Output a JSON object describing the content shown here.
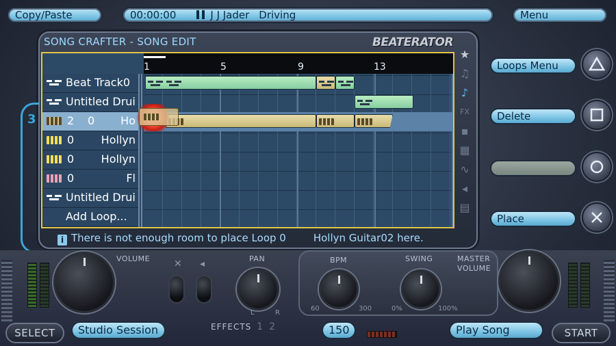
{
  "top_bar": {
    "left_label": "Copy/Paste",
    "time": "00:00:00",
    "artist": "J J Jader",
    "song": "Driving",
    "right_label": "Menu"
  },
  "screen": {
    "title": "SONG CRAFTER - SONG EDIT",
    "brand": "BEATERATOR",
    "ruler": [
      "1",
      "5",
      "9",
      "13"
    ],
    "status_icon": "i",
    "status_text": "There is not enough room to place Loop 0",
    "status_text2": "Hollyn Guitar02 here."
  },
  "tracks": [
    {
      "icon": "drum-icon",
      "label": "Beat Track0"
    },
    {
      "icon": "drum-icon",
      "label": "Untitled Drui"
    },
    {
      "icon": "keys-icon",
      "num1": "2",
      "num2": "0",
      "right": "Ho"
    },
    {
      "icon": "keys-icon",
      "num1": "0",
      "right": "Hollyn"
    },
    {
      "icon": "keys-icon",
      "num1": "0",
      "right": "Hollyn"
    },
    {
      "icon": "keys-icon-pink",
      "num1": "0",
      "right": "Fl"
    },
    {
      "icon": "drum-icon",
      "label": "Untitled Drui"
    },
    {
      "label": "Add Loop..."
    }
  ],
  "selected_track_number": "3",
  "right_buttons": {
    "loops_menu": "Loops Menu",
    "delete": "Delete",
    "blank": "",
    "place": "Place"
  },
  "bottom": {
    "volume_label": "VOLUME",
    "pan_label": "PAN",
    "pan_l": "L",
    "pan_r": "R",
    "effects_label": "EFFECTS",
    "effects_1": "1",
    "effects_2": "2",
    "bpm_label": "BPM",
    "bpm_min": "60",
    "bpm_max": "300",
    "bpm_value": "150",
    "swing_label": "SWING",
    "swing_min": "0%",
    "swing_max": "100%",
    "master_label": "MASTER",
    "master_label2": "VOLUME",
    "select": "SELECT",
    "studio_session": "Studio Session",
    "play_song": "Play Song",
    "start": "START"
  },
  "colors": {
    "accent": "#7cc4e4",
    "editor_border": "#e0c64a",
    "clip_green": "#86cfa2",
    "clip_tan": "#c9b878",
    "error_red": "#c81e14"
  }
}
